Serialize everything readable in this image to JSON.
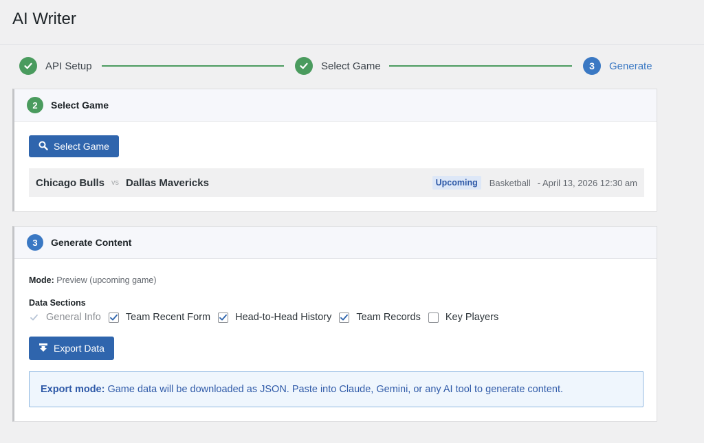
{
  "page": {
    "title": "AI Writer"
  },
  "stepper": {
    "steps": [
      {
        "number": "1",
        "label": "API Setup",
        "status": "complete",
        "icon": "check-icon"
      },
      {
        "number": "2",
        "label": "Select Game",
        "status": "complete",
        "icon": "check-icon"
      },
      {
        "number": "3",
        "label": "Generate",
        "status": "current"
      }
    ]
  },
  "select_game": {
    "number": "2",
    "title": "Select Game",
    "button_label": "Select Game",
    "button_icon": "search-icon",
    "game": {
      "home_team": "Chicago Bulls",
      "vs": "vs",
      "away_team": "Dallas Mavericks",
      "status": "Upcoming",
      "sport": "Basketball",
      "datetime": "- April 13, 2026 12:30 am"
    }
  },
  "generate": {
    "number": "3",
    "title": "Generate Content",
    "mode_label": "Mode:",
    "mode_value": "Preview (upcoming game)",
    "sections_label": "Data Sections",
    "sections": [
      {
        "label": "General Info",
        "checked": true,
        "disabled": true
      },
      {
        "label": "Team Recent Form",
        "checked": true,
        "disabled": false
      },
      {
        "label": "Head-to-Head History",
        "checked": true,
        "disabled": false
      },
      {
        "label": "Team Records",
        "checked": true,
        "disabled": false
      },
      {
        "label": "Key Players",
        "checked": false,
        "disabled": false
      }
    ],
    "export_button_label": "Export Data",
    "export_button_icon": "download-icon",
    "notice_bold": "Export mode:",
    "notice_text": "Game data will be downloaded as JSON. Paste into Claude, Gemini, or any AI tool to generate content."
  },
  "colors": {
    "accent_blue": "#3a78c3",
    "button_blue": "#2f65ad",
    "success_green": "#4a9b5e"
  }
}
